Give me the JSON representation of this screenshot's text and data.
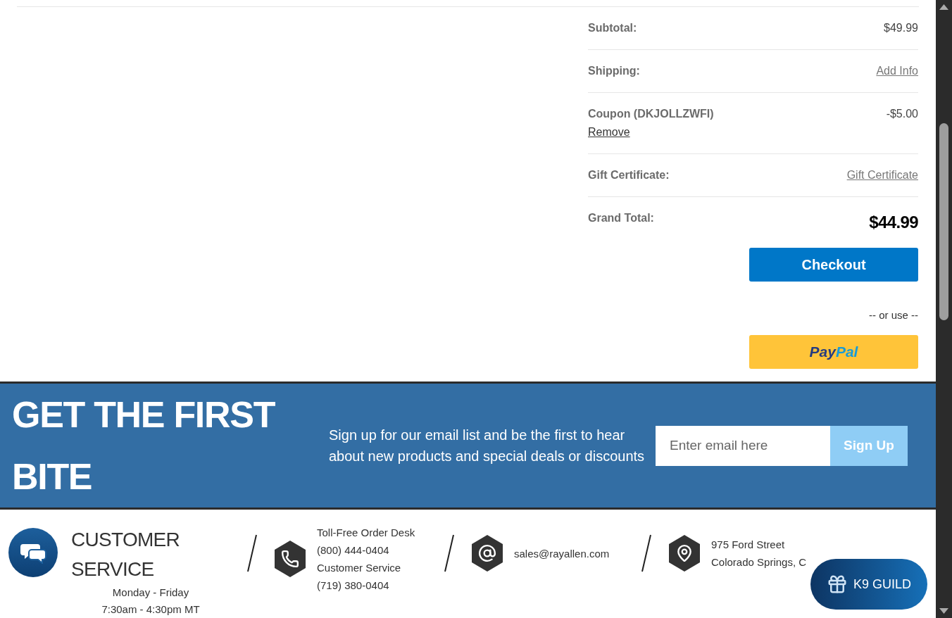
{
  "summary": [
    {
      "kind": "value",
      "label": "Subtotal:",
      "value": "$49.99"
    },
    {
      "kind": "link",
      "label": "Shipping:",
      "value": "Add Info"
    },
    {
      "kind": "coupon",
      "label": "Coupon (DKJOLLZWFI)",
      "value": "-$5.00",
      "action": "Remove"
    },
    {
      "kind": "link",
      "label": "Gift Certificate:",
      "value": "Gift Certificate"
    },
    {
      "kind": "total",
      "label": "Grand Total:",
      "value": "$44.99"
    }
  ],
  "checkout": "Checkout",
  "or_use": "-- or use --",
  "paypal": [
    "Pay",
    "Pal"
  ],
  "signup": {
    "headline": "GET THE FIRST BITE",
    "text": "Sign up for our email list and be the first to hear about new products and special deals or discounts",
    "placeholder": "Enter email here",
    "button": "Sign Up"
  },
  "footer": {
    "title": "CUSTOMER SERVICE",
    "hours": [
      "Monday - Friday",
      "7:30am - 4:30pm MT"
    ],
    "contacts": [
      {
        "kind": "phone",
        "lines": [
          "Toll-Free Order Desk",
          "(800) 444-0404",
          "Customer Service",
          "(719) 380-0404"
        ]
      },
      {
        "kind": "email",
        "lines": [
          "sales@rayallen.com"
        ]
      },
      {
        "kind": "address",
        "lines": [
          "975 Ford Street",
          "Colorado Springs, C"
        ]
      }
    ]
  },
  "guild_button": "K9 GUILD"
}
